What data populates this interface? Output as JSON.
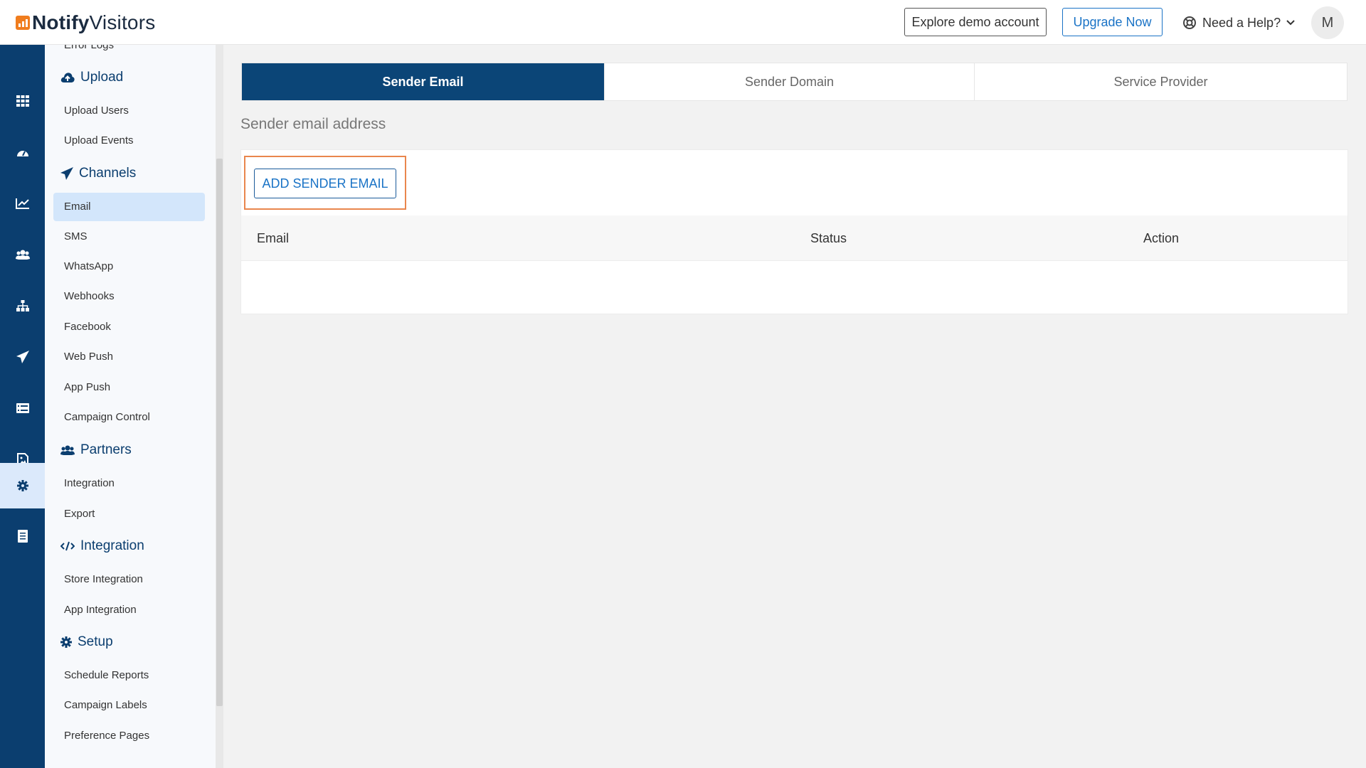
{
  "header": {
    "logo_bold": "Notify",
    "logo_light": "Visitors",
    "demo_label": "Explore demo account",
    "upgrade_label": "Upgrade Now",
    "help_label": "Need a Help?",
    "avatar_initial": "M"
  },
  "rail": {
    "items": [
      "apps-grid-icon",
      "dashboard-gauge-icon",
      "analytics-chart-icon",
      "users-icon",
      "hierarchy-icon",
      "send-icon",
      "list-icon",
      "image-file-icon",
      "settings-gear-icon",
      "document-icon"
    ],
    "active": "settings-gear-icon"
  },
  "menu": {
    "error_logs": "Error Logs",
    "upload": {
      "title": "Upload",
      "items": [
        "Upload Users",
        "Upload Events"
      ]
    },
    "channels": {
      "title": "Channels",
      "items": [
        "Email",
        "SMS",
        "WhatsApp",
        "Webhooks",
        "Facebook",
        "Web Push",
        "App Push",
        "Campaign Control"
      ],
      "active": "Email"
    },
    "partners": {
      "title": "Partners",
      "items": [
        "Integration",
        "Export"
      ]
    },
    "integration": {
      "title": "Integration",
      "items": [
        "Store Integration",
        "App Integration"
      ]
    },
    "setup": {
      "title": "Setup",
      "items": [
        "Schedule Reports",
        "Campaign Labels",
        "Preference Pages"
      ]
    }
  },
  "tabs": [
    {
      "label": "Sender Email",
      "active": true
    },
    {
      "label": "Sender Domain",
      "active": false
    },
    {
      "label": "Service Provider",
      "active": false
    }
  ],
  "main": {
    "section_title": "Sender email address",
    "add_button": "ADD SENDER EMAIL",
    "columns": [
      "Email",
      "Status",
      "Action"
    ]
  },
  "colors": {
    "brand_navy": "#0b3e6f",
    "accent_blue": "#1a73c6",
    "highlight_orange": "#e9864d",
    "logo_orange": "#f07d1e"
  }
}
